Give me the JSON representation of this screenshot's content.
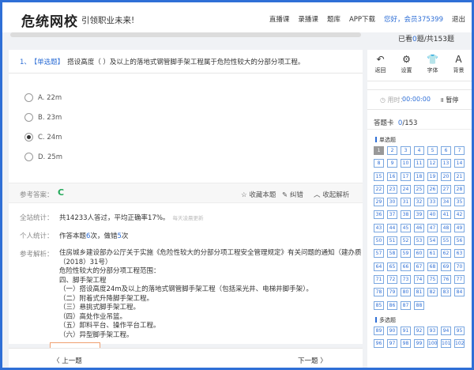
{
  "header": {
    "logo": "危统网校",
    "slogan": "引领职业未来!",
    "nav": [
      "直播课",
      "录播课",
      "题库",
      "APP下载"
    ],
    "user": "您好，会员375399",
    "logout": "退出"
  },
  "progress": {
    "answered_prefix": "已看",
    "answered_count": "0",
    "answered_mid": "题/共",
    "total": "153",
    "answered_suffix": "题",
    "fraction": 0
  },
  "question": {
    "number": "1、",
    "type": "【单选题】",
    "text": "搭设高度（ ）及以上的落地式钢管脚手架工程属于危险性较大的分部分项工程。",
    "options": [
      {
        "label": "A. 22m",
        "selected": false
      },
      {
        "label": "B. 23m",
        "selected": false
      },
      {
        "label": "C. 24m",
        "selected": true
      },
      {
        "label": "D. 25m",
        "selected": false
      }
    ]
  },
  "answer_bar": {
    "ref_label": "参考答案：",
    "ref_answer": "C",
    "favorite": "收藏本题",
    "correct": "纠错",
    "collapse": "收起解析"
  },
  "stats": {
    "all_label": "全站统计：",
    "all_value": "共14233人答过，平均正确率17%。",
    "all_note": "每天凌晨更新",
    "personal_label": "个人统计：",
    "personal_prefix": "作答本题",
    "personal_count": "6",
    "personal_mid": "次，做错",
    "personal_wrong": "5",
    "personal_suffix": "次"
  },
  "analysis": {
    "label": "参考解析：",
    "lines": [
      "住房城乡建设部办公厅关于实施《危险性较大的分部分项工程安全管理规定》有关问题的通知（建办质",
      "（2018）31号）",
      "危险性较大的分部分项工程范围：",
      "四、脚手架工程",
      "（一）搭设高度24m及以上的落地式钢管脚手架工程（包括采光井、电梯井脚手架）。",
      "（二）附着式升降脚手架工程。",
      "（三）悬挑式脚手架工程。",
      "（四）高处作业吊篮。",
      "（五）卸料平台、操作平台工程。",
      "（六）异型脚手架工程。"
    ]
  },
  "bottom": {
    "prev": "上一题",
    "next": "下一题"
  },
  "tools": [
    {
      "label": "返回",
      "icon": "back-arrow-icon",
      "glyph": "↶"
    },
    {
      "label": "设置",
      "icon": "gear-icon",
      "glyph": "⚙"
    },
    {
      "label": "字体",
      "icon": "shirt-icon",
      "glyph": "👕"
    },
    {
      "label": "背景",
      "icon": "font-size-icon",
      "glyph": "A"
    }
  ],
  "timer": {
    "label": "用时：",
    "value": "00:00:00",
    "pause": "暂停"
  },
  "answer_card": {
    "title": "答题卡",
    "done": "0",
    "total": "/153",
    "single_title": "单选题",
    "multi_title": "多选题",
    "current": 1,
    "single_count": 88,
    "multi_visible": 14
  }
}
